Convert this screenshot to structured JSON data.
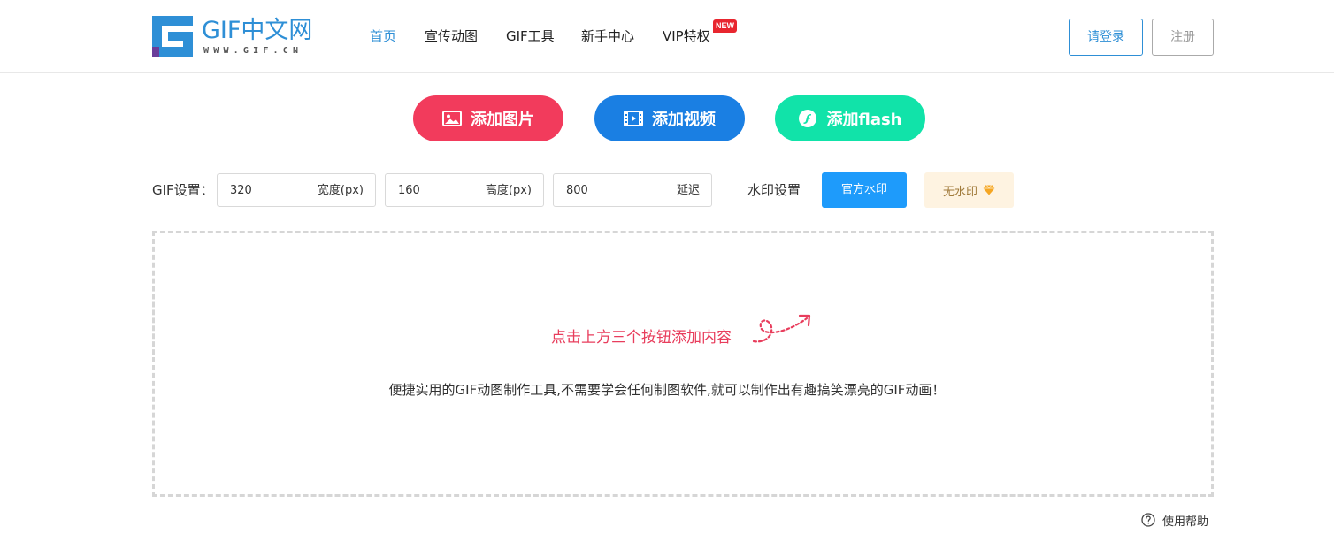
{
  "header": {
    "logo": {
      "text": "GIF中文网",
      "url": "WWW.GIF.CN"
    },
    "nav": [
      {
        "label": "首页",
        "active": true
      },
      {
        "label": "宣传动图"
      },
      {
        "label": "GIF工具"
      },
      {
        "label": "新手中心"
      },
      {
        "label": "VIP特权"
      }
    ],
    "new_badge": "NEW",
    "login_label": "请登录",
    "register_label": "注册"
  },
  "add_buttons": {
    "image": {
      "label": "添加图片",
      "icon": "image-icon",
      "color": "#f23b5c"
    },
    "video": {
      "label": "添加视频",
      "icon": "video-icon",
      "color": "#1a7fe3"
    },
    "flash": {
      "label": "添加flash",
      "icon": "flash-icon",
      "color": "#11e3a9"
    }
  },
  "settings": {
    "label": "GIF设置：",
    "width": {
      "value": "320",
      "unit": "宽度(px)"
    },
    "height": {
      "value": "160",
      "unit": "高度(px)"
    },
    "delay": {
      "value": "800",
      "unit": "延迟"
    },
    "watermark_label": "水印设置",
    "official_watermark_label": "官方水印",
    "no_watermark_label": "无水印"
  },
  "dropzone": {
    "hint": "点击上方三个按钮添加内容",
    "description": "便捷实用的GIF动图制作工具,不需要学会任何制图软件,就可以制作出有趣搞笑漂亮的GIF动画！"
  },
  "help": {
    "label": "使用帮助",
    "icon": "question-icon"
  },
  "colors": {
    "accent": "#2e8fd6",
    "hint": "#e83d5c",
    "official_watermark": "#1e9bfb",
    "no_watermark_bg": "#fef3e1",
    "new_badge": "#e8262f"
  }
}
